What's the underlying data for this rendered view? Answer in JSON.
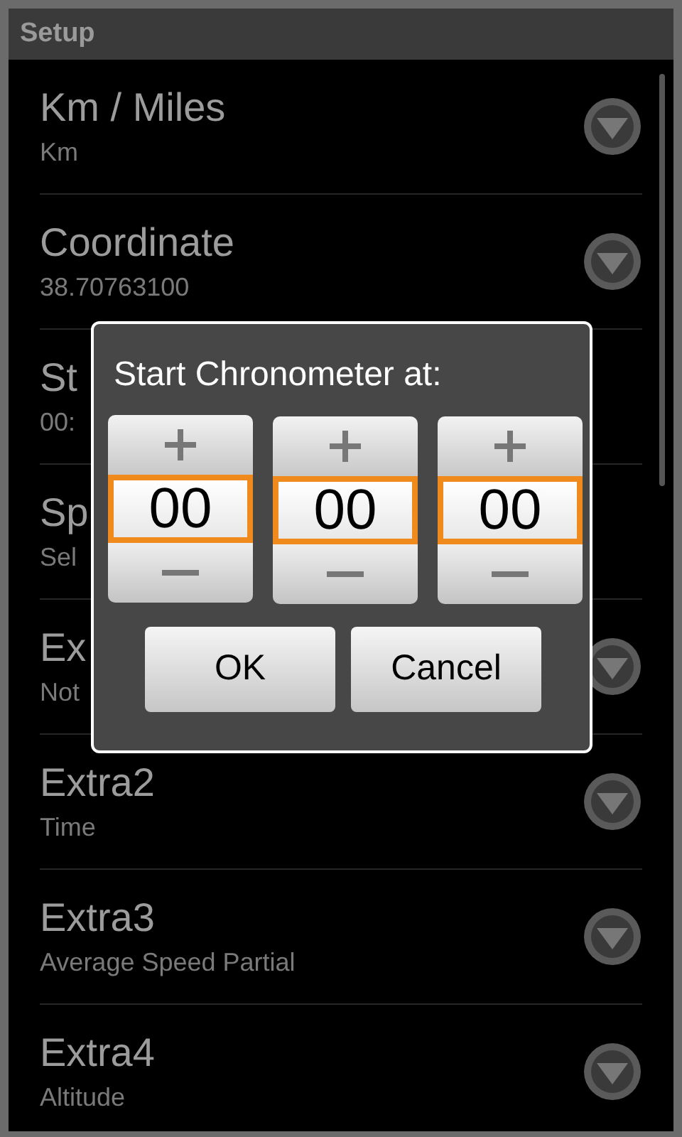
{
  "window": {
    "title": "Setup"
  },
  "rows": [
    {
      "title": "Km / Miles",
      "summary": "Km",
      "dropdown": true
    },
    {
      "title": "Coordinate",
      "summary": "38.70763100",
      "dropdown": true
    },
    {
      "title": "St",
      "summary": "00:",
      "dropdown": false
    },
    {
      "title": "Sp",
      "summary": "Sel",
      "dropdown": false
    },
    {
      "title": "Ex",
      "summary": "Not",
      "dropdown": true
    },
    {
      "title": "Extra2",
      "summary": "Time",
      "dropdown": true
    },
    {
      "title": "Extra3",
      "summary": "Average Speed Partial",
      "dropdown": true
    },
    {
      "title": "Extra4",
      "summary": "Altitude",
      "dropdown": true
    }
  ],
  "dialog": {
    "title": "Start Chronometer at:",
    "pickers": [
      {
        "value": "00"
      },
      {
        "value": "00"
      },
      {
        "value": "00"
      }
    ],
    "buttons": [
      "OK",
      "Cancel"
    ]
  }
}
